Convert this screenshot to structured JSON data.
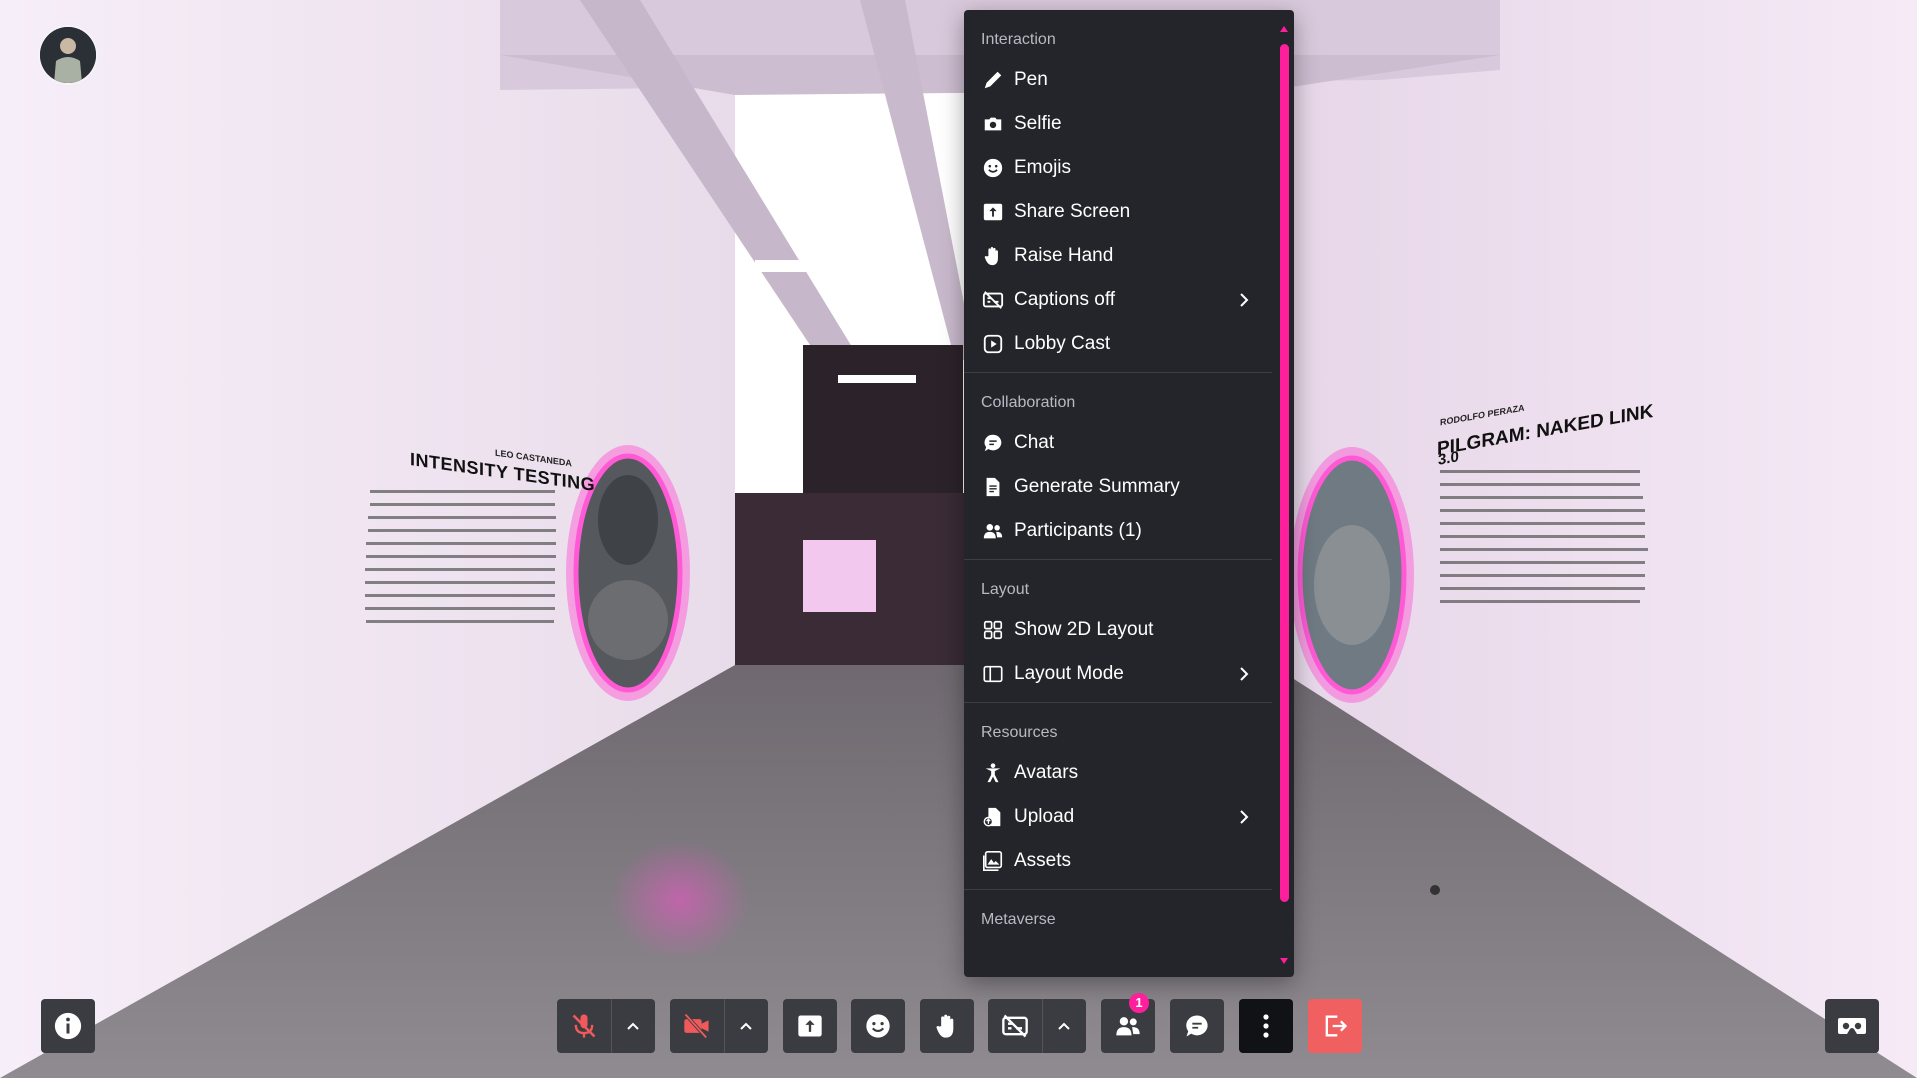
{
  "menu": {
    "sections": [
      {
        "title": "Interaction",
        "items": [
          {
            "label": "Pen",
            "icon": "pen-icon"
          },
          {
            "label": "Selfie",
            "icon": "camera-icon"
          },
          {
            "label": "Emojis",
            "icon": "smiley-icon"
          },
          {
            "label": "Share Screen",
            "icon": "share-screen-icon"
          },
          {
            "label": "Raise Hand",
            "icon": "hand-icon"
          },
          {
            "label": "Captions off",
            "icon": "captions-off-icon",
            "submenu": true
          },
          {
            "label": "Lobby Cast",
            "icon": "lobby-cast-icon"
          }
        ]
      },
      {
        "title": "Collaboration",
        "items": [
          {
            "label": "Chat",
            "icon": "chat-icon"
          },
          {
            "label": "Generate Summary",
            "icon": "document-icon"
          },
          {
            "label": "Participants (1)",
            "icon": "people-icon"
          }
        ]
      },
      {
        "title": "Layout",
        "items": [
          {
            "label": "Show 2D Layout",
            "icon": "grid-icon"
          },
          {
            "label": "Layout Mode",
            "icon": "layout-mode-icon",
            "submenu": true
          }
        ]
      },
      {
        "title": "Resources",
        "items": [
          {
            "label": "Avatars",
            "icon": "avatar-figure-icon"
          },
          {
            "label": "Upload",
            "icon": "upload-icon",
            "submenu": true
          },
          {
            "label": "Assets",
            "icon": "image-icon"
          }
        ]
      },
      {
        "title": "Metaverse",
        "items": []
      }
    ]
  },
  "exhibits": {
    "left": {
      "artist": "LEO CASTANEDA",
      "title": "INTENSITY TESTING"
    },
    "right": {
      "artist": "RODOLFO PERAZA",
      "title": "PILGRAM: NAKED LINK",
      "title_line2": "3.0"
    }
  },
  "toolbar": {
    "participants_badge": "1",
    "buttons": [
      "info-icon",
      "mic-off-icon",
      "camera-off-icon",
      "share-screen-icon",
      "smiley-icon",
      "hand-icon",
      "captions-off-icon",
      "people-icon",
      "chat-icon",
      "more-icon",
      "leave-icon",
      "vr-headset-icon"
    ]
  },
  "colors": {
    "accent": "#ff1f9c",
    "menu_bg": "#23252b",
    "leave": "#f06060",
    "toolbar_btn": "#3a3c42"
  }
}
